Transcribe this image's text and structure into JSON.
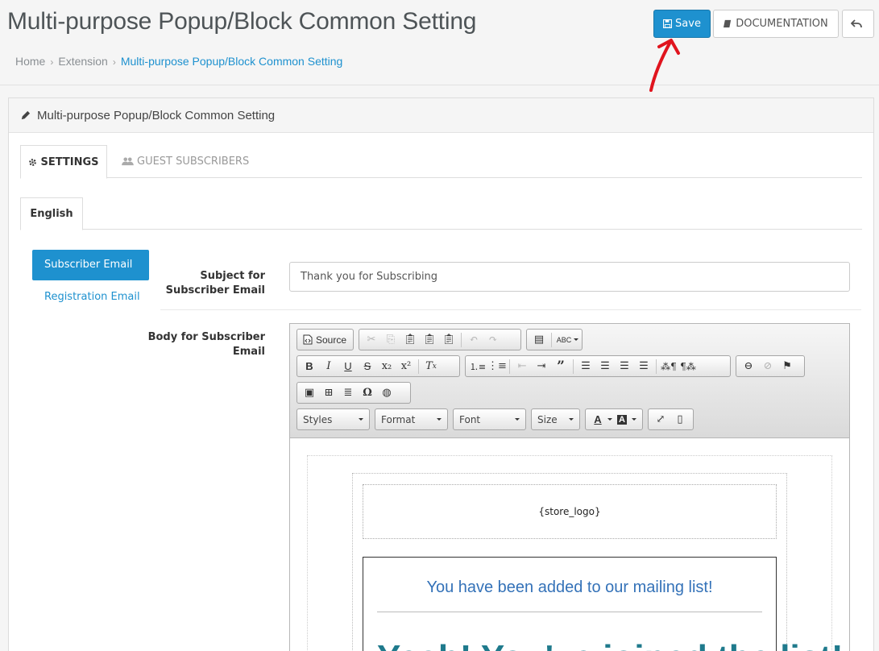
{
  "header": {
    "title": "Multi-purpose Popup/Block Common Setting",
    "save_label": "Save",
    "documentation_label": "DOCUMENTATION"
  },
  "breadcrumb": [
    "Home",
    "Extension",
    "Multi-purpose Popup/Block Common Setting"
  ],
  "panel": {
    "title": "Multi-purpose Popup/Block Common Setting"
  },
  "tabs": [
    {
      "label": "SETTINGS",
      "active": true
    },
    {
      "label": "GUEST SUBSCRIBERS",
      "active": false
    }
  ],
  "language_tab": "English",
  "email_nav": [
    {
      "label": "Subscriber Email",
      "active": true
    },
    {
      "label": "Registration Email",
      "active": false
    }
  ],
  "form": {
    "subject_label": "Subject for Subscriber Email",
    "subject_value": "Thank you for Subscribing",
    "body_label": "Body for Subscriber Email"
  },
  "editor": {
    "source_label": "Source",
    "dropdowns": [
      "Styles",
      "Format",
      "Font",
      "Size"
    ]
  },
  "email_preview": {
    "logo_placeholder": "{store_logo}",
    "heading": "You have been added to our mailing list!",
    "big_text": "Yeah! You've joined the list!"
  },
  "colors": {
    "primary": "#1e91cf",
    "heading_blue": "#3472b8",
    "annotation_red": "#e0141e"
  }
}
